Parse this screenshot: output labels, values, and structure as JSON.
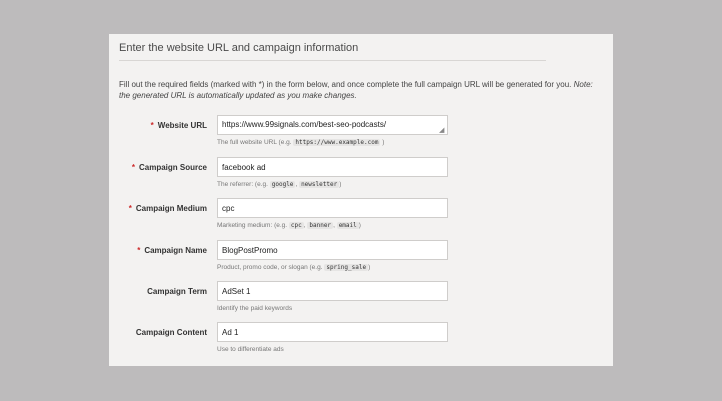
{
  "form": {
    "title": "Enter the website URL and campaign information",
    "intro_text": "Fill out the required fields (marked with *) in the form below, and once complete the full campaign URL will be generated for you.",
    "intro_note": "Note: the generated URL is automatically updated as you make changes.",
    "required_marker": "*",
    "fields": [
      {
        "label": "Website URL",
        "required": true,
        "value": "https://www.99signals.com/best-seo-podcasts/",
        "help_prefix": "The full website URL (e.g.",
        "help_codes": [
          "https://www.example.com"
        ],
        "help_suffix": ")"
      },
      {
        "label": "Campaign Source",
        "required": true,
        "value": "facebook ad",
        "help_prefix": "The referrer: (e.g.",
        "help_codes": [
          "google",
          "newsletter"
        ],
        "help_suffix": ")"
      },
      {
        "label": "Campaign Medium",
        "required": true,
        "value": "cpc",
        "help_prefix": "Marketing medium: (e.g.",
        "help_codes": [
          "cpc",
          "banner",
          "email"
        ],
        "help_suffix": ")"
      },
      {
        "label": "Campaign Name",
        "required": true,
        "value": "BlogPostPromo",
        "help_prefix": "Product, promo code, or slogan (e.g.",
        "help_codes": [
          "spring_sale"
        ],
        "help_suffix": ")"
      },
      {
        "label": "Campaign Term",
        "required": false,
        "value": "AdSet 1",
        "help_prefix": "Identify the paid keywords",
        "help_codes": [],
        "help_suffix": ""
      },
      {
        "label": "Campaign Content",
        "required": false,
        "value": "Ad 1",
        "help_prefix": "Use to differentiate ads",
        "help_codes": [],
        "help_suffix": ""
      }
    ]
  },
  "colors": {
    "background": "#bdbbbc",
    "panel": "#f3f2f1",
    "required": "#cc2a2a"
  }
}
